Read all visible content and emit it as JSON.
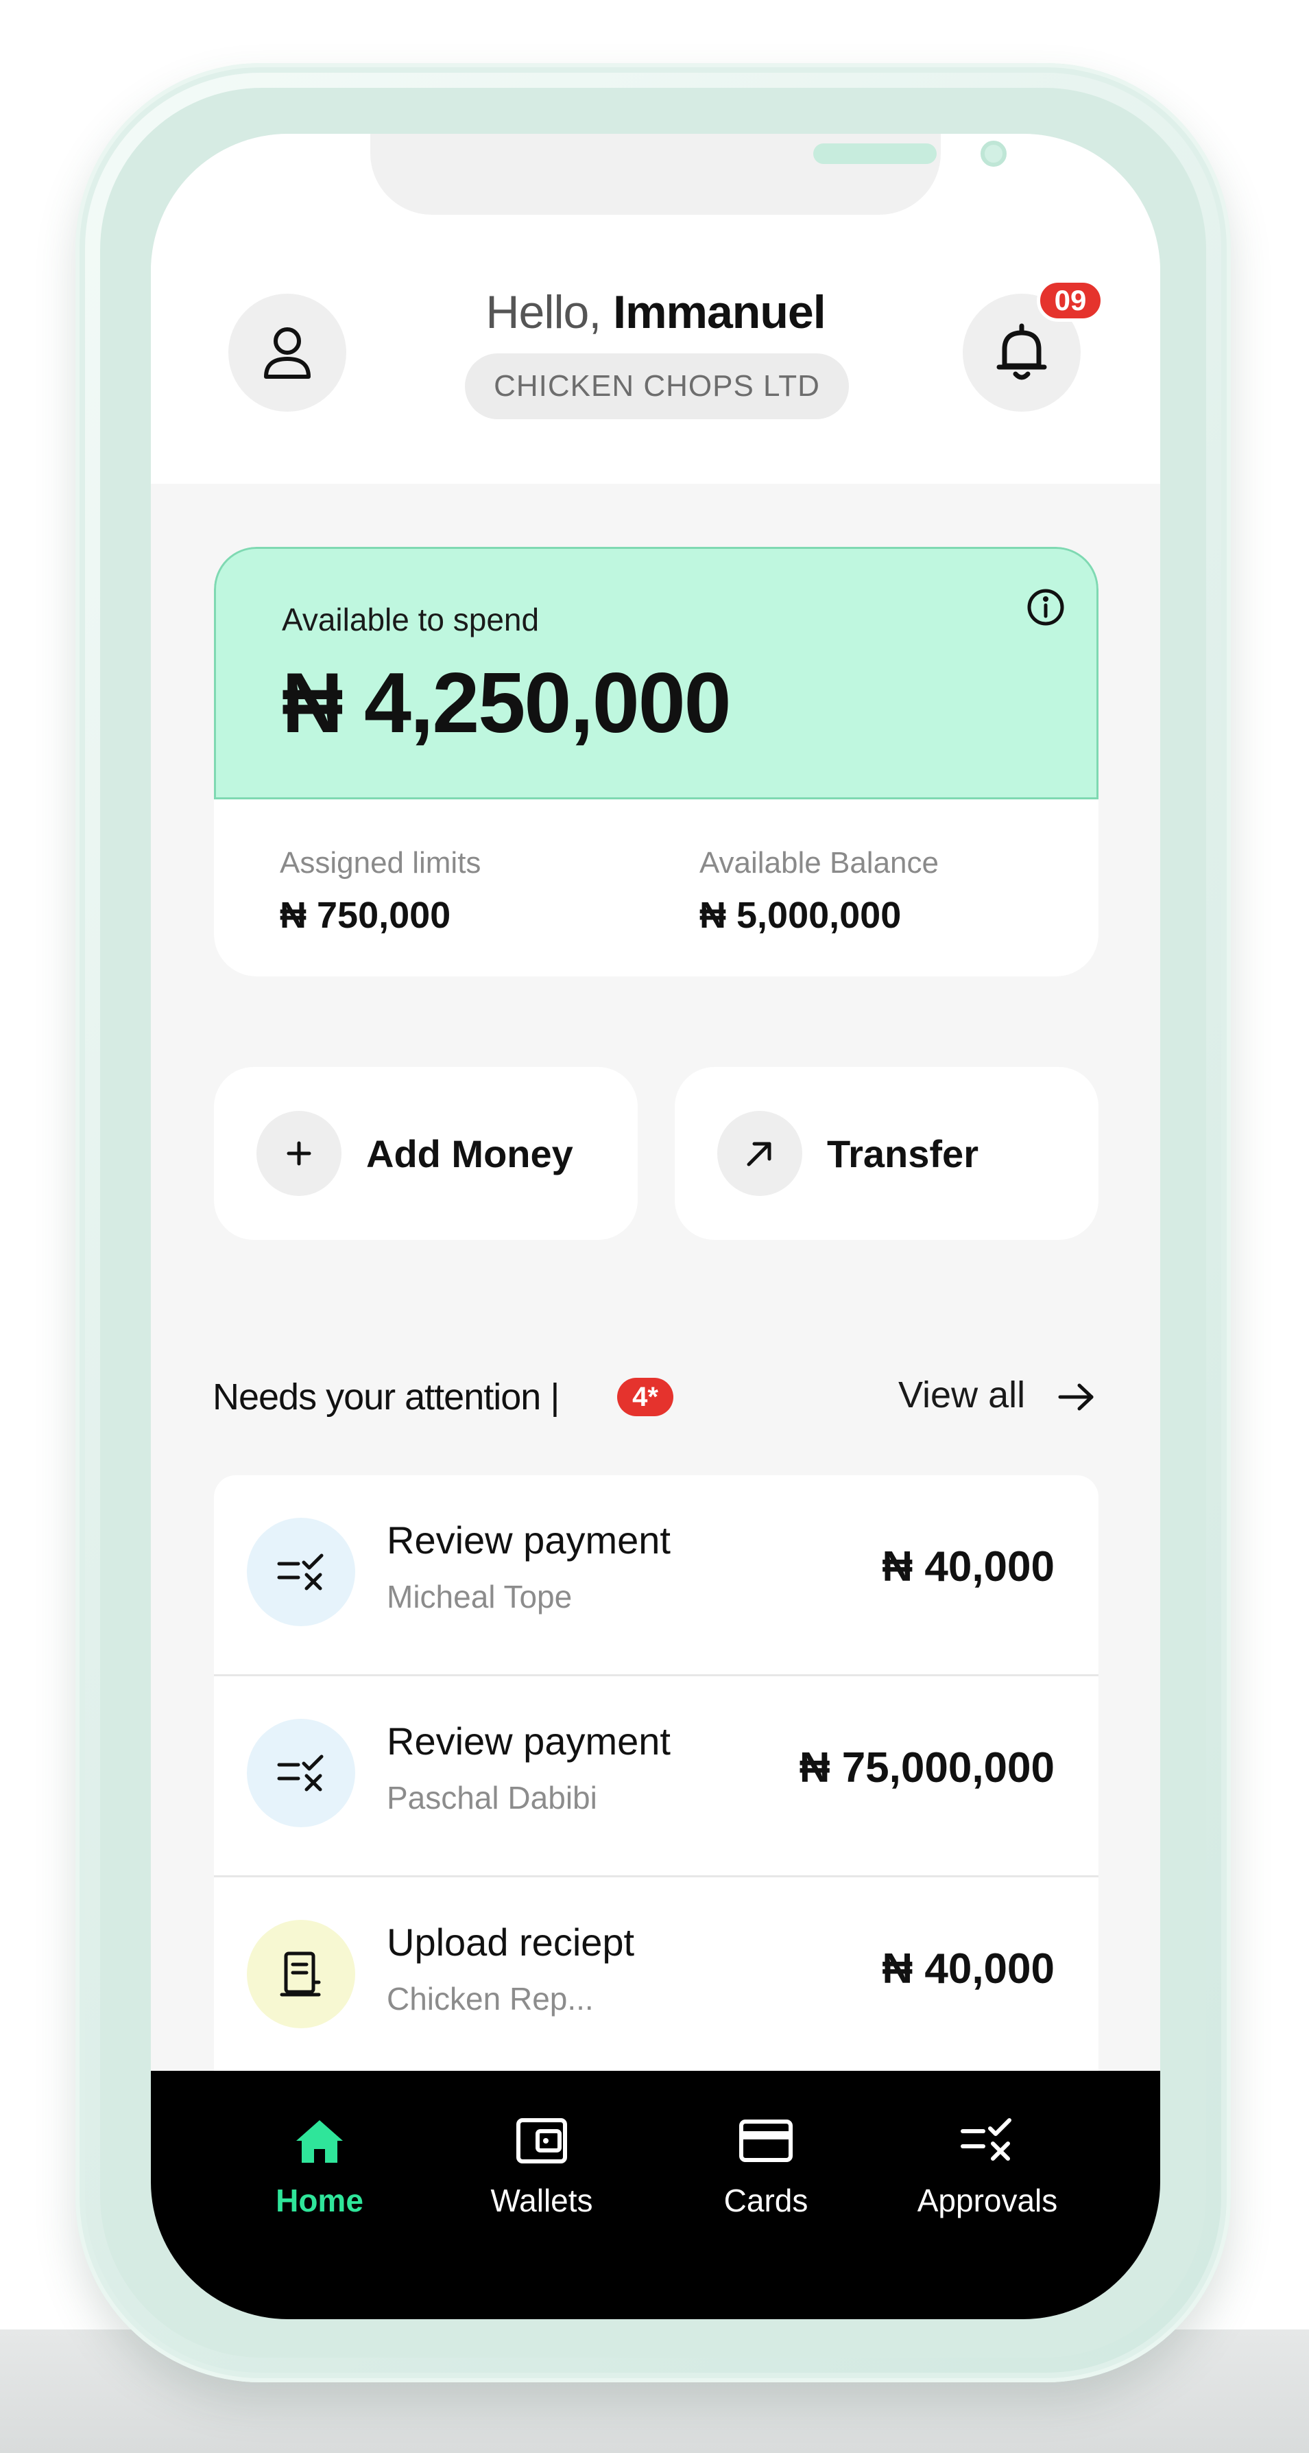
{
  "header": {
    "greeting_prefix": "Hello,",
    "user_name": "Immanuel",
    "company": "CHICKEN CHOPS LTD",
    "notification_count": "09"
  },
  "balance": {
    "available_label": "Available to spend",
    "available_value": "₦ 4,250,000",
    "assigned_label": "Assigned limits",
    "assigned_value": "₦ 750,000",
    "balance_label": "Available Balance",
    "balance_value": "₦ 5,000,000"
  },
  "actions": {
    "add_money": "Add Money",
    "transfer": "Transfer"
  },
  "attention": {
    "title": "Needs your attention |",
    "count": "4*",
    "view_all": "View all",
    "items": [
      {
        "title": "Review payment",
        "subtitle": "Micheal Tope",
        "amount": "₦ 40,000",
        "icon": "approval-icon"
      },
      {
        "title": "Review payment",
        "subtitle": "Paschal Dabibi",
        "amount": "₦ 75,000,000",
        "icon": "approval-icon"
      },
      {
        "title": "Upload reciept",
        "subtitle": "Chicken Rep...",
        "amount": "₦ 40,000",
        "icon": "receipt-icon"
      }
    ]
  },
  "nav": {
    "items": [
      {
        "label": "Home",
        "icon": "home-icon",
        "active": true
      },
      {
        "label": "Wallets",
        "icon": "wallet-icon",
        "active": false
      },
      {
        "label": "Cards",
        "icon": "card-icon",
        "active": false
      },
      {
        "label": "Approvals",
        "icon": "approvals-icon",
        "active": false
      }
    ]
  },
  "colors": {
    "accent_green": "#2fe59a",
    "card_mint": "#bff7df",
    "alert_red": "#e5332d",
    "approval_bg": "#e6f3fb",
    "receipt_bg": "#f7f8d2"
  }
}
